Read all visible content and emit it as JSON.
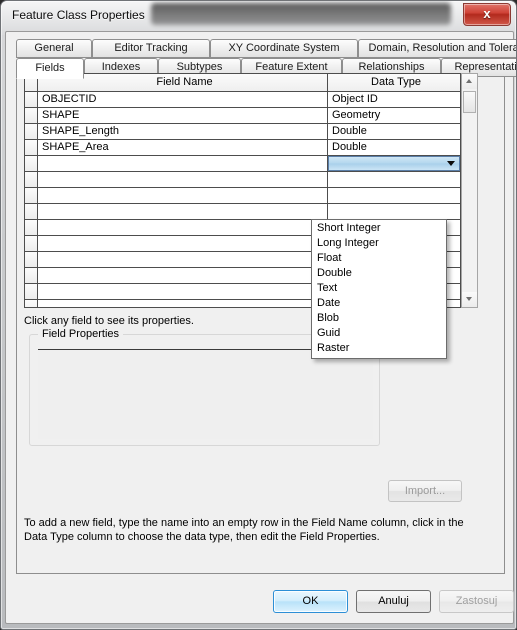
{
  "window": {
    "title": "Feature Class Properties",
    "close_icon": "close-icon",
    "close_label": "x"
  },
  "tabs": {
    "row1": [
      {
        "label": "General",
        "selected": false
      },
      {
        "label": "Editor Tracking",
        "selected": false
      },
      {
        "label": "XY Coordinate System",
        "selected": false
      },
      {
        "label": "Domain, Resolution and Tolerance",
        "selected": false
      }
    ],
    "row2": [
      {
        "label": "Fields",
        "selected": true
      },
      {
        "label": "Indexes",
        "selected": false
      },
      {
        "label": "Subtypes",
        "selected": false
      },
      {
        "label": "Feature Extent",
        "selected": false
      },
      {
        "label": "Relationships",
        "selected": false
      },
      {
        "label": "Representations",
        "selected": false
      }
    ]
  },
  "grid": {
    "columns": [
      "Field Name",
      "Data Type"
    ],
    "rows": [
      {
        "field_name": "OBJECTID",
        "data_type": "Object ID"
      },
      {
        "field_name": "SHAPE",
        "data_type": "Geometry"
      },
      {
        "field_name": "SHAPE_Length",
        "data_type": "Double"
      },
      {
        "field_name": "SHAPE_Area",
        "data_type": "Double"
      },
      {
        "field_name": "",
        "data_type": "",
        "active": true
      },
      {
        "field_name": "",
        "data_type": ""
      },
      {
        "field_name": "",
        "data_type": ""
      },
      {
        "field_name": "",
        "data_type": ""
      },
      {
        "field_name": "",
        "data_type": ""
      },
      {
        "field_name": "",
        "data_type": ""
      },
      {
        "field_name": "",
        "data_type": ""
      },
      {
        "field_name": "",
        "data_type": ""
      },
      {
        "field_name": "",
        "data_type": ""
      },
      {
        "field_name": "",
        "data_type": ""
      }
    ],
    "scrollbar": {
      "up_icon": "scroll-up-arrow-icon",
      "down_icon": "scroll-down-arrow-icon"
    }
  },
  "dropdown": {
    "arrow_icon": "chevron-down-icon",
    "selected_value": "",
    "options": [
      "Short Integer",
      "Long Integer",
      "Float",
      "Double",
      "Text",
      "Date",
      "Blob",
      "Guid",
      "Raster"
    ]
  },
  "hints": {
    "top": "Click any field to see its properties.",
    "bottom": "To add a new field, type the name into an empty row in the Field Name column, click in the Data Type column to choose the data type, then edit the Field Properties."
  },
  "field_properties": {
    "legend": "Field Properties",
    "content": ""
  },
  "buttons": {
    "import": "Import...",
    "import_accel": "I",
    "ok": "OK",
    "cancel": "Anuluj",
    "apply": "Zastosuj",
    "apply_accel": "Z"
  },
  "colors": {
    "accent": "#b4d7ee",
    "ok_border": "#2c8fd6",
    "close_red": "#cf4236",
    "disabled_text": "#a0a0a0"
  }
}
